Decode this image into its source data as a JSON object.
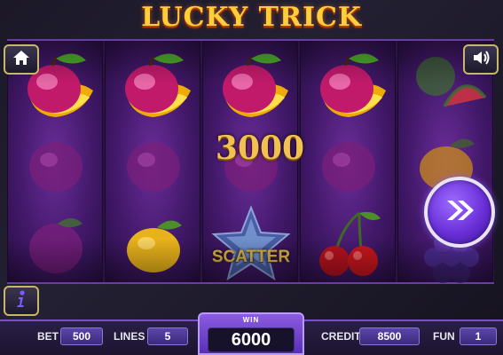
{
  "game": {
    "title": "LUCKY TRICK",
    "win_amount_overlay": "3000",
    "scatter_label": "SCATTER"
  },
  "reels": [
    [
      "plum-fire",
      "plum",
      "plum"
    ],
    [
      "plum-fire",
      "plum",
      "lemon"
    ],
    [
      "plum-fire",
      "plum",
      "scatter-star"
    ],
    [
      "plum-fire",
      "plum",
      "cherry"
    ],
    [
      "watermelon",
      "lemon",
      "grapes"
    ]
  ],
  "buttons": {
    "home_icon": "home-icon",
    "sound_icon": "speaker-icon",
    "info_icon": "info-icon",
    "spin_icon": "double-chevron-right-icon"
  },
  "bottom_bar": {
    "bet_label": "BET",
    "bet_value": "500",
    "lines_label": "LINES",
    "lines_value": "5",
    "win_label": "WIN",
    "win_value": "6000",
    "credit_label": "CREDIT",
    "credit_value": "8500",
    "fun_label": "FUN",
    "fun_value": "1"
  },
  "colors": {
    "title": "#ffcf3a",
    "reel_background": "#43196b",
    "spin_button": "#6a2fd8",
    "panel_accent": "#7a4fd0"
  }
}
